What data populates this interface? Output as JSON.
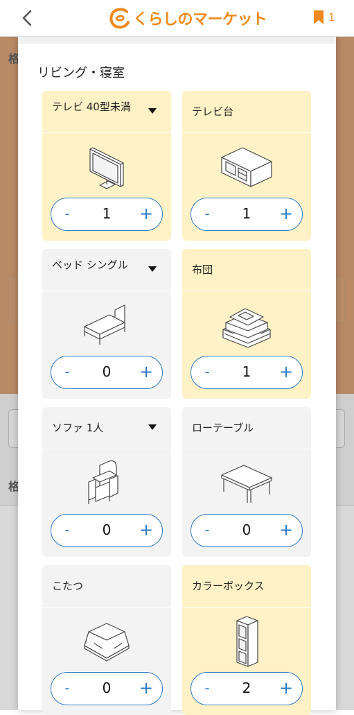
{
  "header": {
    "logo_text": "くらしのマーケット",
    "bookmark_count": "1"
  },
  "background": {
    "heading_top": "格",
    "heading_mid": "格"
  },
  "modal": {
    "section_title": "リビング・寝室",
    "items": [
      {
        "label": "テレビ 40型未満",
        "has_dropdown": true,
        "value": "1",
        "selected": true,
        "icon": "tv-icon"
      },
      {
        "label": "テレビ台",
        "has_dropdown": false,
        "value": "1",
        "selected": true,
        "icon": "tv-stand-icon"
      },
      {
        "label": "ベッド シングル",
        "has_dropdown": true,
        "value": "0",
        "selected": false,
        "icon": "bed-icon"
      },
      {
        "label": "布団",
        "has_dropdown": false,
        "value": "1",
        "selected": true,
        "icon": "futon-icon"
      },
      {
        "label": "ソファ 1人",
        "has_dropdown": true,
        "value": "0",
        "selected": false,
        "icon": "sofa-icon"
      },
      {
        "label": "ローテーブル",
        "has_dropdown": false,
        "value": "0",
        "selected": false,
        "icon": "low-table-icon"
      },
      {
        "label": "こたつ",
        "has_dropdown": false,
        "value": "0",
        "selected": false,
        "icon": "kotatsu-icon"
      },
      {
        "label": "カラーボックス",
        "has_dropdown": false,
        "value": "2",
        "selected": true,
        "icon": "color-box-icon"
      }
    ],
    "minus_label": "-",
    "plus_label": "+"
  },
  "colors": {
    "accent": "#f08a1e",
    "stepper_blue": "#2b79c8",
    "selected_card": "#fff2c6",
    "unselected_card": "#f3f3f3"
  }
}
